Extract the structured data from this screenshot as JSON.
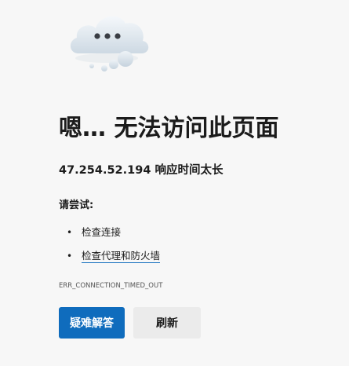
{
  "error_page": {
    "title": "嗯… 无法访问此页面",
    "subtitle": "47.254.52.194 响应时间太长",
    "try_label": "请尝试:",
    "suggestions": [
      {
        "text": "检查连接",
        "is_link": false
      },
      {
        "text": "检查代理和防火墙",
        "is_link": true
      }
    ],
    "error_code": "ERR_CONNECTION_TIMED_OUT",
    "buttons": {
      "diagnose_label": "疑难解答",
      "refresh_label": "刷新"
    },
    "colors": {
      "accent": "#0f6cbd",
      "background": "#f7f7f7",
      "text": "#1b1b1b"
    },
    "icon": "cloud-with-ellipsis-icon"
  }
}
